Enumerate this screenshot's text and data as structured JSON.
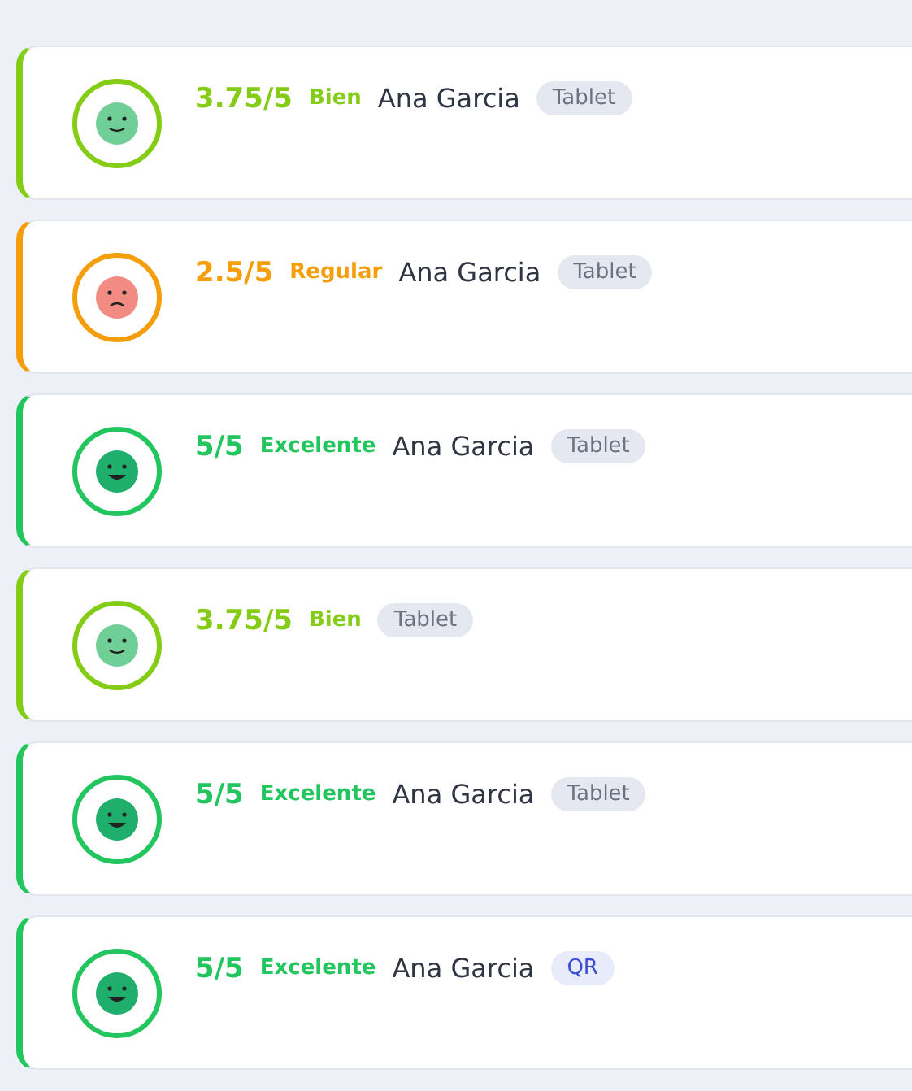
{
  "reviews": [
    {
      "kind": "bien",
      "score": "3.75/5",
      "rating_label": "Bien",
      "name": "Ana Garcia",
      "source": {
        "kind": "device",
        "label": "Tablet"
      }
    },
    {
      "kind": "regular",
      "score": "2.5/5",
      "rating_label": "Regular",
      "name": "Ana Garcia",
      "source": {
        "kind": "device",
        "label": "Tablet"
      }
    },
    {
      "kind": "excelente",
      "score": "5/5",
      "rating_label": "Excelente",
      "name": "Ana Garcia",
      "source": {
        "kind": "device",
        "label": "Tablet"
      }
    },
    {
      "kind": "bien",
      "score": "3.75/5",
      "rating_label": "Bien",
      "source": {
        "kind": "device",
        "label": "Tablet"
      }
    },
    {
      "kind": "excelente",
      "score": "5/5",
      "rating_label": "Excelente",
      "name": "Ana Garcia",
      "source": {
        "kind": "device",
        "label": "Tablet"
      }
    },
    {
      "kind": "excelente",
      "score": "5/5",
      "rating_label": "Excelente",
      "name": "Ana Garcia",
      "source": {
        "kind": "qr",
        "label": "QR"
      }
    }
  ]
}
